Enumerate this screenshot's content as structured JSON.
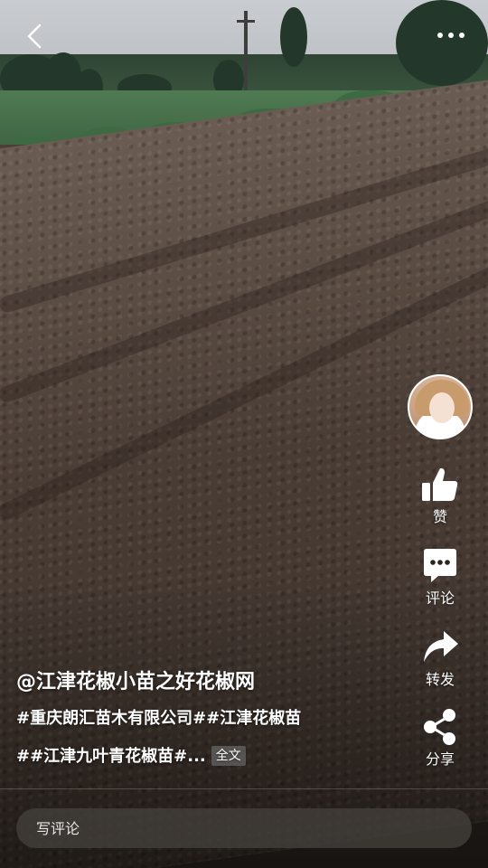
{
  "topbar": {
    "back_icon": "chevron-left-icon",
    "more_icon": "more-dots-icon"
  },
  "author": {
    "name": "@江津花椒小苗之好花椒网"
  },
  "caption": {
    "line1": "#重庆朗汇苗木有限公司##江津花椒苗",
    "line2": "##江津九叶青花椒苗#...",
    "more_label": "全文"
  },
  "actions": {
    "like": {
      "label": "赞",
      "icon": "thumbs-up-icon"
    },
    "comment": {
      "label": "评论",
      "icon": "comment-bubble-icon"
    },
    "forward": {
      "label": "转发",
      "icon": "forward-arrow-icon"
    },
    "share": {
      "label": "分享",
      "icon": "share-nodes-icon"
    }
  },
  "comment_box": {
    "placeholder": "写评论"
  },
  "colors": {
    "text": "#ffffff",
    "input_bg": "#46413e"
  }
}
